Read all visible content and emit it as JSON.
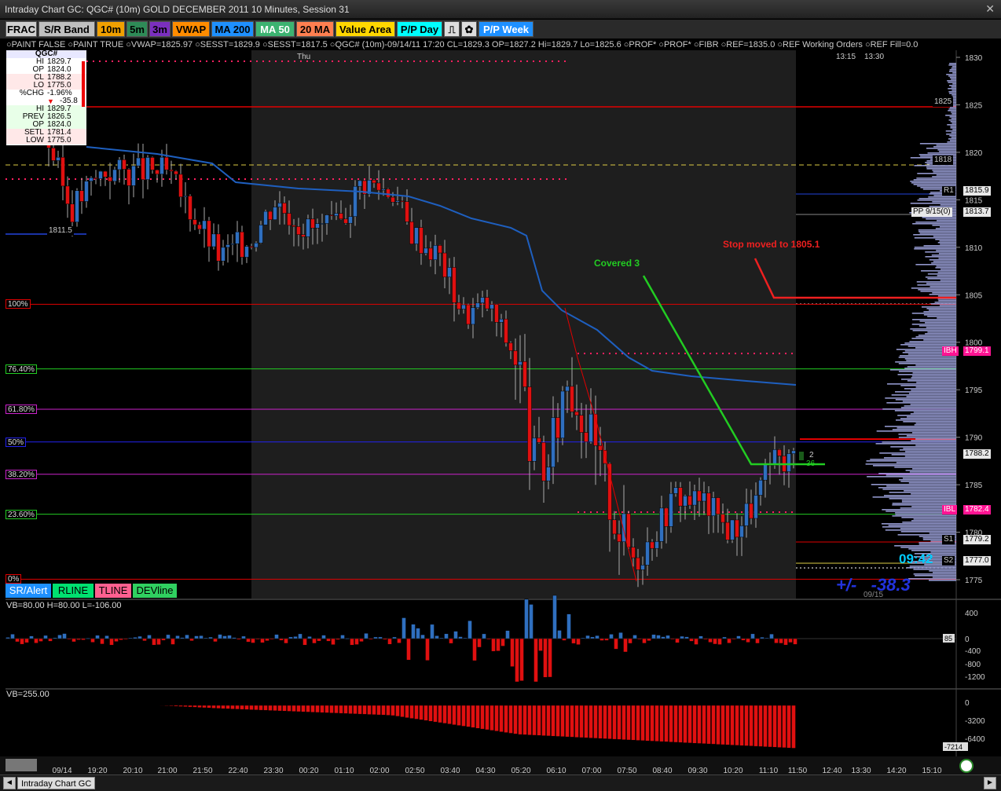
{
  "window": {
    "title": "Intraday Chart GC: QGC# (10m) GOLD DECEMBER 2011 10 Minutes, Session 31"
  },
  "toolbar": {
    "buttons": [
      {
        "label": "FRAC",
        "bg": "#d0d0d0",
        "fg": "#000"
      },
      {
        "label": "S/R Band",
        "bg": "#bfbfbf",
        "fg": "#000"
      },
      {
        "label": "10m",
        "bg": "#f0a000",
        "fg": "#000"
      },
      {
        "label": "5m",
        "bg": "#2e8b57",
        "fg": "#000"
      },
      {
        "label": "3m",
        "bg": "#7b2fbf",
        "fg": "#000"
      },
      {
        "label": "VWAP",
        "bg": "#ff8c00",
        "fg": "#000"
      },
      {
        "label": "MA 200",
        "bg": "#1e90ff",
        "fg": "#000"
      },
      {
        "label": "MA 50",
        "bg": "#3cb371",
        "fg": "#fff"
      },
      {
        "label": "20 MA",
        "bg": "#ff7f50",
        "fg": "#000"
      },
      {
        "label": "Value Area",
        "bg": "#ffd700",
        "fg": "#000"
      },
      {
        "label": "P/P Day",
        "bg": "#00ffff",
        "fg": "#000"
      },
      {
        "label": "P/P Week",
        "bg": "#1e90ff",
        "fg": "#fff"
      }
    ]
  },
  "legend": {
    "text": "○PAINT FALSE ○PAINT TRUE ○VWAP=1825.97 ○SESST=1829.9 ○SESST=1817.5 ○QGC# (10m)-09/14/11 17:20 CL=1829.3 OP=1827.2 Hi=1829.7 Lo=1825.6 ○PROF* ○PROF* ○FIBR ○REF=1835.0 ○REF Working Orders ○REF Fill=0.0"
  },
  "infobox": {
    "symbol": "QGC#",
    "rows": [
      {
        "k": "HI",
        "v": "1829.7"
      },
      {
        "k": "OP",
        "v": "1824.0"
      },
      {
        "k": "CL",
        "v": "1788.2"
      },
      {
        "k": "LO",
        "v": "1775.0"
      },
      {
        "k": "%CHG",
        "v": "-1.96%"
      },
      {
        "k": "",
        "v": "-35.8"
      },
      {
        "k": "HI",
        "v": "1829.7"
      },
      {
        "k": "PREV",
        "v": "1826.5"
      },
      {
        "k": "OP",
        "v": "1824.0"
      },
      {
        "k": "SETL",
        "v": "1781.4"
      },
      {
        "k": "LOW",
        "v": "1775.0"
      }
    ]
  },
  "session_label": "Thu",
  "top_times": [
    "13:15",
    "13:30"
  ],
  "fib_levels": [
    {
      "label": "100%",
      "price": 1804.0,
      "color": "#e00000"
    },
    {
      "label": "76.40%",
      "price": 1797.2,
      "color": "#22cc22"
    },
    {
      "label": "61.80%",
      "price": 1792.95,
      "color": "#cc22cc"
    },
    {
      "label": "50%",
      "price": 1789.5,
      "color": "#2222ee"
    },
    {
      "label": "38.20%",
      "price": 1786.1,
      "color": "#cc22cc"
    },
    {
      "label": "23.60%",
      "price": 1781.9,
      "color": "#22cc22"
    },
    {
      "label": "0%",
      "price": 1775.05,
      "color": "#e00000"
    }
  ],
  "price_axis": {
    "ticks": [
      "1830",
      "1825",
      "1820",
      "1815",
      "1810",
      "1805",
      "1800",
      "1795",
      "1790",
      "1785",
      "1780",
      "1775"
    ]
  },
  "price_tags": [
    {
      "label": "1825",
      "price": 1825.0,
      "bg": "#000",
      "fg": "#ccc"
    },
    {
      "label": "1818",
      "price": 1818.9,
      "bg": "#000",
      "fg": "#ccc"
    },
    {
      "label": "1811.5",
      "price": 1811.5,
      "bg": "#000",
      "fg": "#ccc"
    },
    {
      "label": "R1",
      "price": 1815.9,
      "bg": "#000",
      "fg": "#ccc"
    },
    {
      "label": "1815.9",
      "price": 1815.9,
      "bg": "#e8e8e8",
      "fg": "#000"
    },
    {
      "label": "PP 9/15(0)",
      "price": 1813.7,
      "bg": "#e8e8e8",
      "fg": "#000"
    },
    {
      "label": "1813.7",
      "price": 1813.7,
      "bg": "#e8e8e8",
      "fg": "#000"
    },
    {
      "label": "IBH",
      "price": 1799.1,
      "bg": "#ff1493",
      "fg": "#fff"
    },
    {
      "label": "1799.1",
      "price": 1799.1,
      "bg": "#ff1493",
      "fg": "#fff"
    },
    {
      "label": "1788.2",
      "price": 1788.2,
      "bg": "#e8e8e8",
      "fg": "#000"
    },
    {
      "label": "IBL",
      "price": 1782.4,
      "bg": "#ff1493",
      "fg": "#fff"
    },
    {
      "label": "1782.4",
      "price": 1782.4,
      "bg": "#ff1493",
      "fg": "#fff"
    },
    {
      "label": "S1",
      "price": 1779.2,
      "bg": "#000",
      "fg": "#ccc"
    },
    {
      "label": "1779.2",
      "price": 1779.2,
      "bg": "#e8e8e8",
      "fg": "#000"
    },
    {
      "label": "S2",
      "price": 1777.0,
      "bg": "#000",
      "fg": "#ccc"
    },
    {
      "label": "1777.0",
      "price": 1777.0,
      "bg": "#e8e8e8",
      "fg": "#000"
    }
  ],
  "annotations": {
    "covered": "Covered 3",
    "stop": "Stop moved to 1805.1",
    "clock": "09:42",
    "range_text": "+/-   -38.3",
    "date_tag": "09/15",
    "bid_qty": "2",
    "ask_qty": "36"
  },
  "analysis_buttons": [
    {
      "label": "SR/Alert",
      "bg": "#1e90ff",
      "fg": "#fff"
    },
    {
      "label": "RLINE",
      "bg": "#00e070",
      "fg": "#000"
    },
    {
      "label": "TLINE",
      "bg": "#ff6090",
      "fg": "#000"
    },
    {
      "label": "DEVline",
      "bg": "#30d060",
      "fg": "#000"
    }
  ],
  "indicator1": {
    "label": "VB=80.00 H=80.00 L=-106.00",
    "ticks": [
      "400",
      "0",
      "-400",
      "-800",
      "-1200"
    ],
    "value_tag": "85"
  },
  "indicator2": {
    "label": "VB=255.00",
    "ticks": [
      "0",
      "-3200",
      "-6400"
    ],
    "value_tag": "-7214"
  },
  "time_axis": {
    "labels": [
      "09/14",
      "19:20",
      "20:10",
      "21:00",
      "21:50",
      "22:40",
      "23:30",
      "00:20",
      "01:10",
      "02:00",
      "02:50",
      "03:40",
      "04:30",
      "05:20",
      "06:10",
      "07:00",
      "07:50",
      "08:40",
      "09:30",
      "10:20",
      "11:10",
      "11:50",
      "12:40",
      "13:30",
      "14:20",
      "15:10"
    ]
  },
  "statusbar": {
    "tab_label": "Intraday Chart GC"
  },
  "colors": {
    "up": "#2f6fbf",
    "down": "#e01010",
    "vwap": "#1e5fbf",
    "panel_bg": "#000",
    "session_bg": "#1e1e1e"
  }
}
